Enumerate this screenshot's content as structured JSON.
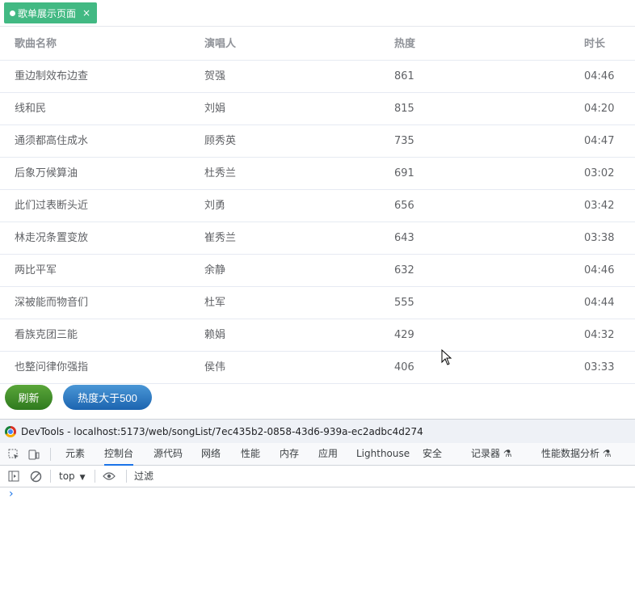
{
  "tag": {
    "label": "歌单展示页面",
    "close": "×"
  },
  "table": {
    "headers": [
      "歌曲名称",
      "演唱人",
      "热度",
      "时长"
    ],
    "rows": [
      [
        "重边制效布边查",
        "贺强",
        "861",
        "04:46"
      ],
      [
        "线和民",
        "刘娟",
        "815",
        "04:20"
      ],
      [
        "通须都高住成水",
        "顾秀英",
        "735",
        "04:47"
      ],
      [
        "后象万候算油",
        "杜秀兰",
        "691",
        "03:02"
      ],
      [
        "此们过表断头近",
        "刘勇",
        "656",
        "03:42"
      ],
      [
        "林走况条置变放",
        "崔秀兰",
        "643",
        "03:38"
      ],
      [
        "两比平军",
        "余静",
        "632",
        "04:46"
      ],
      [
        "深被能而物音们",
        "杜军",
        "555",
        "04:44"
      ],
      [
        "看族克团三能",
        "赖娟",
        "429",
        "04:32"
      ],
      [
        "也整问律你强指",
        "侯伟",
        "406",
        "03:33"
      ]
    ]
  },
  "buttons": {
    "refresh": "刷新",
    "filter": "热度大于500"
  },
  "devtools": {
    "title": "DevTools - localhost:5173/web/songList/7ec435b2-0858-43d6-939a-ec2adbc4d274",
    "tabs": [
      "元素",
      "控制台",
      "源代码",
      "网络",
      "性能",
      "内存",
      "应用",
      "Lighthouse",
      "安全",
      "记录器 ⚗",
      "性能数据分析 ⚗"
    ],
    "active_tab": "控制台",
    "context": "top",
    "filter_placeholder": "过滤",
    "prompt": "›"
  },
  "colors": {
    "accent": "#42b983",
    "refresh": "#3d8b28",
    "filter": "#2a76c0",
    "devtools_blue": "#1a73e8"
  }
}
